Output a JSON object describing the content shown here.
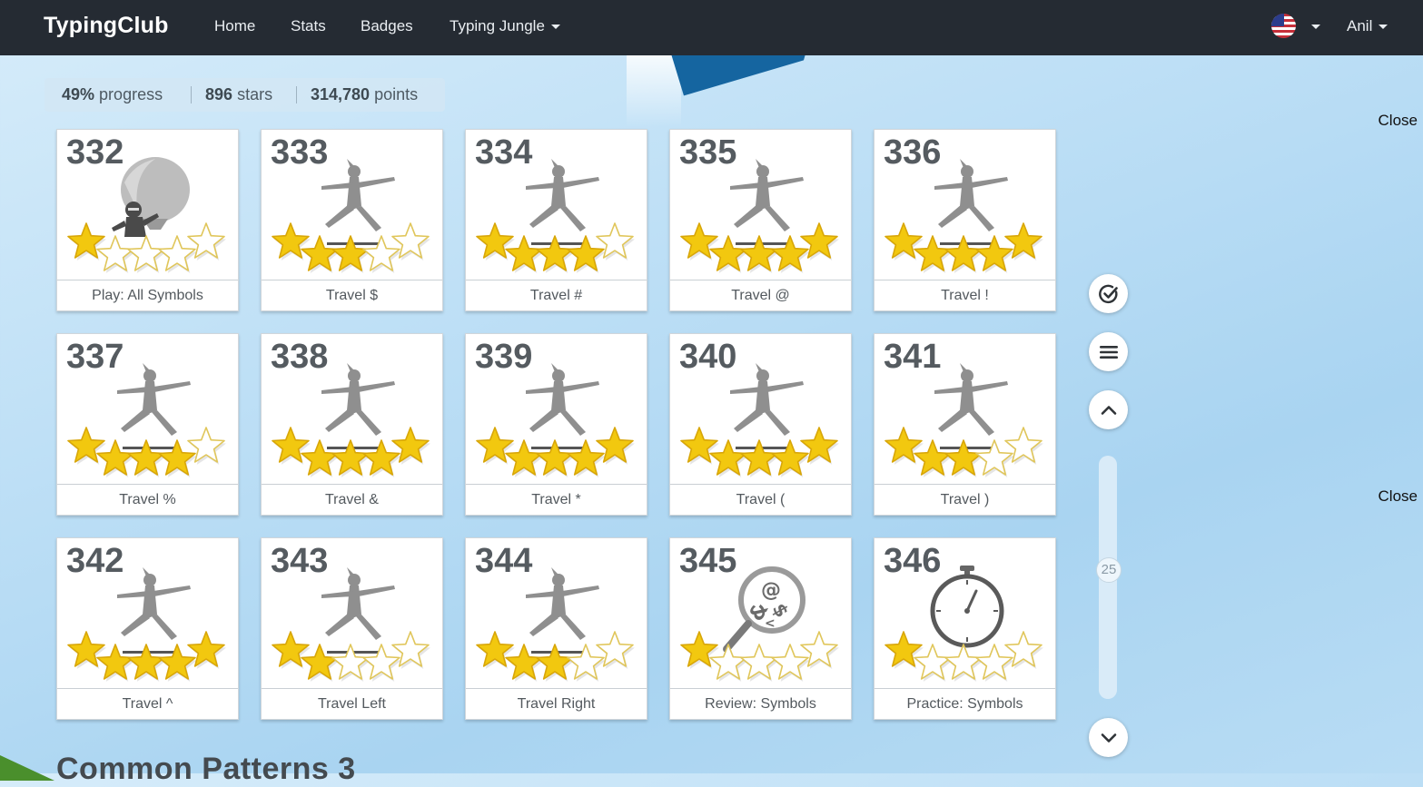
{
  "navbar": {
    "brand": "TypingClub",
    "items": [
      "Home",
      "Stats",
      "Badges",
      "Typing Jungle"
    ],
    "user": "Anil"
  },
  "progress": {
    "percent": "49%",
    "percent_label": "progress",
    "stars": "896",
    "stars_label": "stars",
    "points": "314,780",
    "points_label": "points"
  },
  "close_links": [
    "Close",
    "Close"
  ],
  "lessons": [
    {
      "num": "332",
      "title": "Play: All Symbols",
      "art": "balloon-ninja-icon",
      "stars": 1
    },
    {
      "num": "333",
      "title": "Travel $",
      "art": "yoga-pose-icon",
      "stars": 3
    },
    {
      "num": "334",
      "title": "Travel #",
      "art": "yoga-pose-icon",
      "stars": 4
    },
    {
      "num": "335",
      "title": "Travel @",
      "art": "yoga-pose-icon",
      "stars": 5
    },
    {
      "num": "336",
      "title": "Travel !",
      "art": "yoga-pose-icon",
      "stars": 5
    },
    {
      "num": "337",
      "title": "Travel %",
      "art": "yoga-pose-icon",
      "stars": 4
    },
    {
      "num": "338",
      "title": "Travel &",
      "art": "yoga-pose-icon",
      "stars": 5
    },
    {
      "num": "339",
      "title": "Travel *",
      "art": "yoga-pose-icon",
      "stars": 5
    },
    {
      "num": "340",
      "title": "Travel (",
      "art": "yoga-pose-icon",
      "stars": 5
    },
    {
      "num": "341",
      "title": "Travel )",
      "art": "yoga-pose-icon",
      "stars": 3
    },
    {
      "num": "342",
      "title": "Travel ^",
      "art": "yoga-pose-icon",
      "stars": 5
    },
    {
      "num": "343",
      "title": "Travel Left",
      "art": "yoga-pose-icon",
      "stars": 2
    },
    {
      "num": "344",
      "title": "Travel Right",
      "art": "yoga-pose-icon",
      "stars": 3
    },
    {
      "num": "345",
      "title": "Review: Symbols",
      "art": "magnifier-symbols-icon",
      "stars": 1
    },
    {
      "num": "346",
      "title": "Practice: Symbols",
      "art": "stopwatch-icon",
      "stars": 1
    }
  ],
  "max_stars": 5,
  "slider": {
    "value": "25"
  },
  "side_controls": [
    "check-circle-icon",
    "menu-icon",
    "chevron-up-icon",
    "chevron-down-icon"
  ],
  "next_section": "Common Patterns 3",
  "colors": {
    "navbar": "#252b33",
    "star_gold": "#f2c80f",
    "star_outline": "#e0c65a"
  }
}
